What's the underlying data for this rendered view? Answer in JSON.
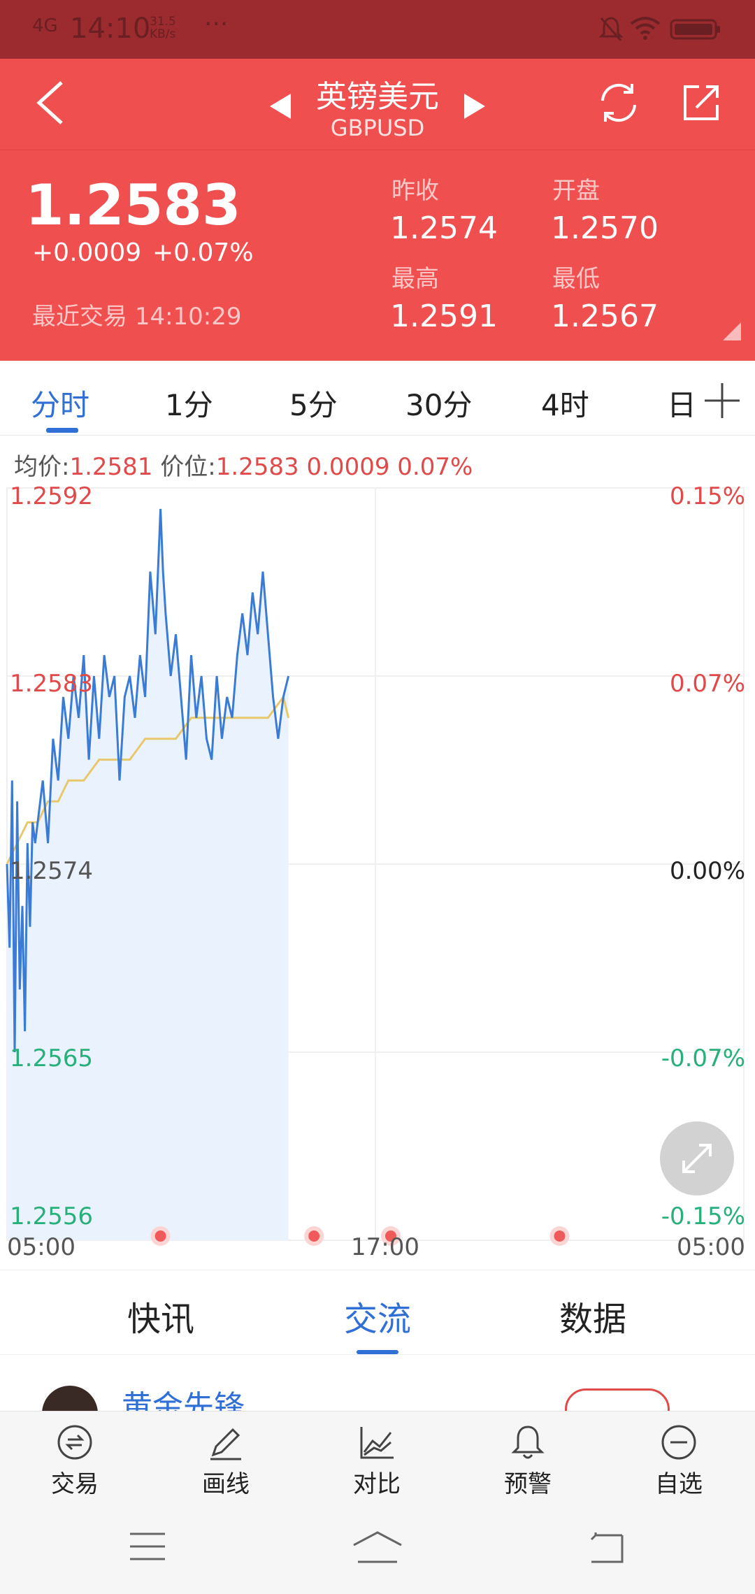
{
  "status_bar": {
    "time": "14:10",
    "signal": "4G",
    "net_speed_value": "31.5",
    "net_speed_unit": "KB/s",
    "more": "···",
    "icons": [
      "mute-bell-icon",
      "wifi-icon",
      "battery-icon"
    ]
  },
  "header": {
    "title": "英镑美元",
    "subtitle": "GBPUSD",
    "icons": [
      "back-icon",
      "prev-triangle-icon",
      "next-triangle-icon",
      "refresh-icon",
      "share-icon"
    ]
  },
  "quote": {
    "price": "1.2583",
    "change": "+0.0009",
    "change_pct": "+0.07%",
    "last_trade_label": "最近交易",
    "last_trade_time": "14:10:29",
    "prev_close_label": "昨收",
    "prev_close": "1.2574",
    "open_label": "开盘",
    "open": "1.2570",
    "high_label": "最高",
    "high": "1.2591",
    "low_label": "最低",
    "low": "1.2567"
  },
  "period_tabs": {
    "items": [
      "分时",
      "1分",
      "5分",
      "30分",
      "4时",
      "日"
    ],
    "active": 0,
    "add_icon": "plus-icon"
  },
  "info_line": {
    "avg_label": "均价:",
    "avg_value": "1.2581",
    "price_label": "价位:",
    "price_value": "1.2583 0.0009 0.07%"
  },
  "chart_data": {
    "type": "line",
    "y_ticks": [
      "1.2592",
      "1.2583",
      "1.2574",
      "1.2565",
      "1.2556"
    ],
    "y_pct_ticks": [
      "0.15%",
      "0.07%",
      "0.00%",
      "-0.07%",
      "-0.15%"
    ],
    "x_ticks": [
      "05:00",
      "17:00",
      "05:00"
    ],
    "ylim": [
      1.2556,
      1.2592
    ],
    "xlim": [
      0,
      1440
    ],
    "grid": true,
    "series": [
      {
        "values_x": [
          0,
          5,
          10,
          15,
          20,
          25,
          30,
          35,
          40,
          45,
          50,
          55,
          60,
          70,
          80,
          90,
          100,
          110,
          120,
          130,
          140,
          150,
          160,
          170,
          180,
          190,
          200,
          210,
          220,
          225,
          230,
          240,
          250,
          260,
          270,
          280,
          290,
          300,
          305,
          310,
          320,
          330,
          340,
          350,
          360,
          370,
          380,
          390,
          400,
          410,
          420,
          430,
          440,
          450,
          460,
          470,
          480,
          490,
          500,
          510,
          520,
          530,
          540,
          550
        ],
        "values_y": [
          1.2574,
          1.257,
          1.2578,
          1.2565,
          1.2577,
          1.2568,
          1.2572,
          1.2566,
          1.2575,
          1.2571,
          1.2576,
          1.2575,
          1.2576,
          1.2578,
          1.2575,
          1.258,
          1.2578,
          1.2582,
          1.258,
          1.2583,
          1.2581,
          1.2584,
          1.2579,
          1.2583,
          1.258,
          1.2584,
          1.2582,
          1.2583,
          1.2578,
          1.258,
          1.2582,
          1.2583,
          1.2581,
          1.2584,
          1.2582,
          1.2588,
          1.2585,
          1.2591,
          1.2588,
          1.2586,
          1.2583,
          1.2585,
          1.2582,
          1.2579,
          1.2584,
          1.2581,
          1.2583,
          1.258,
          1.2579,
          1.2583,
          1.258,
          1.2582,
          1.2581,
          1.2584,
          1.2586,
          1.2584,
          1.2587,
          1.2585,
          1.2588,
          1.2585,
          1.2582,
          1.258,
          1.2582,
          1.2583
        ]
      },
      {
        "values_x": [
          0,
          20,
          40,
          60,
          80,
          100,
          120,
          150,
          180,
          210,
          240,
          270,
          300,
          330,
          360,
          390,
          420,
          450,
          480,
          510,
          540,
          550
        ],
        "values_y": [
          1.2574,
          1.2575,
          1.2576,
          1.2576,
          1.2577,
          1.2577,
          1.2578,
          1.2578,
          1.2579,
          1.2579,
          1.2579,
          1.258,
          1.258,
          1.258,
          1.2581,
          1.2581,
          1.2581,
          1.2581,
          1.2581,
          1.2581,
          1.2582,
          1.2581
        ]
      }
    ],
    "colors": {
      "price": "#3a7bd5",
      "avg": "#e8c86a",
      "fill": "#eaf3fd"
    },
    "markers_x": [
      300,
      600,
      750,
      1080
    ]
  },
  "content_tabs": {
    "items": [
      "快讯",
      "交流",
      "数据"
    ],
    "active": 1
  },
  "feed_peek": {
    "name": "黄金先锋"
  },
  "toolbar": {
    "items": [
      {
        "label": "交易",
        "icon": "trade-icon"
      },
      {
        "label": "画线",
        "icon": "pen-icon"
      },
      {
        "label": "对比",
        "icon": "compare-chart-icon"
      },
      {
        "label": "预警",
        "icon": "bell-icon"
      },
      {
        "label": "自选",
        "icon": "minus-circle-icon"
      }
    ]
  },
  "nav_bar": {
    "icons": [
      "menu-icon",
      "home-icon",
      "back-nav-icon"
    ]
  },
  "colors": {
    "header_red": "#f04f4f",
    "status_red": "#9c2b2f",
    "accent_blue": "#2f6fd6",
    "up_red": "#e04a4a",
    "down_green": "#27b07a"
  }
}
